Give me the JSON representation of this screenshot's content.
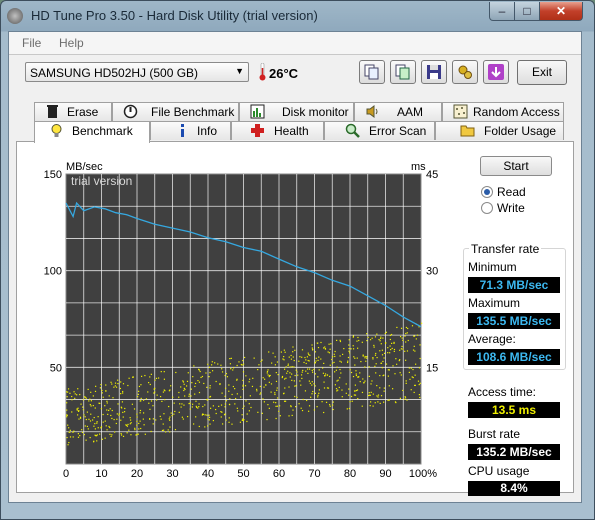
{
  "window": {
    "title": "HD Tune Pro 3.50 - Hard Disk Utility (trial version)",
    "min_glyph": "–",
    "max_glyph": "□",
    "close_glyph": "✕"
  },
  "menu": {
    "file": "File",
    "help": "Help"
  },
  "toolbar": {
    "drive": "SAMSUNG HD502HJ (500 GB)",
    "temperature": "26°C",
    "exit_label": "Exit",
    "icons": [
      "copy-icon",
      "copy-info-icon",
      "save-icon",
      "options-icon",
      "screenshot-icon"
    ]
  },
  "tabs": {
    "row1": [
      "Erase",
      "File Benchmark",
      "Disk monitor",
      "AAM",
      "Random Access"
    ],
    "row2": [
      "Benchmark",
      "Info",
      "Health",
      "Error Scan",
      "Folder Usage"
    ],
    "active": "Benchmark"
  },
  "chart_data": {
    "type": "line",
    "title": "",
    "watermark": "trial version",
    "ylabel_left": "MB/sec",
    "ylabel_right": "ms",
    "y_left_ticks": [
      150,
      100,
      50
    ],
    "y_right_ticks": [
      45,
      30,
      15
    ],
    "x_ticks": [
      "0",
      "10",
      "20",
      "30",
      "40",
      "50",
      "60",
      "70",
      "80",
      "90",
      "100%"
    ],
    "ylim_left": [
      0,
      150
    ],
    "ylim_right": [
      0,
      45
    ],
    "xlim": [
      0,
      100
    ],
    "grid": true,
    "background": "#404040",
    "series": [
      {
        "name": "Transfer rate",
        "color": "#35a8e0",
        "x": [
          0,
          2,
          3,
          5,
          8,
          11,
          14,
          17,
          20,
          25,
          30,
          35,
          40,
          45,
          50,
          55,
          60,
          65,
          70,
          75,
          80,
          85,
          90,
          95,
          100
        ],
        "y": [
          135,
          128,
          135,
          131,
          133,
          132,
          130,
          129,
          127,
          124,
          122,
          120,
          117,
          115,
          112,
          110,
          106,
          102,
          99,
          95,
          92,
          87,
          82,
          76,
          71
        ]
      },
      {
        "name": "Access time",
        "color": "#f0f000",
        "x_range": [
          0,
          100
        ],
        "y_start_range_ms": [
          3,
          12
        ],
        "y_end_range_ms": [
          10,
          22
        ],
        "count": 900
      }
    ]
  },
  "controls": {
    "start_label": "Start",
    "read_label": "Read",
    "write_label": "Write",
    "selected_mode": "Read"
  },
  "transfer_rate": {
    "group_title": "Transfer rate",
    "minimum_label": "Minimum",
    "minimum_value": "71.3 MB/sec",
    "maximum_label": "Maximum",
    "maximum_value": "135.5 MB/sec",
    "average_label": "Average:",
    "average_value": "108.6 MB/sec"
  },
  "stats": {
    "access_time_label": "Access time:",
    "access_time_value": "13.5 ms",
    "burst_rate_label": "Burst rate",
    "burst_rate_value": "135.2 MB/sec",
    "cpu_usage_label": "CPU usage",
    "cpu_usage_value": "8.4%"
  },
  "colors": {
    "accent_blue": "#35a8e0",
    "accent_yellow": "#f0f000",
    "close_red": "#c2402a"
  }
}
